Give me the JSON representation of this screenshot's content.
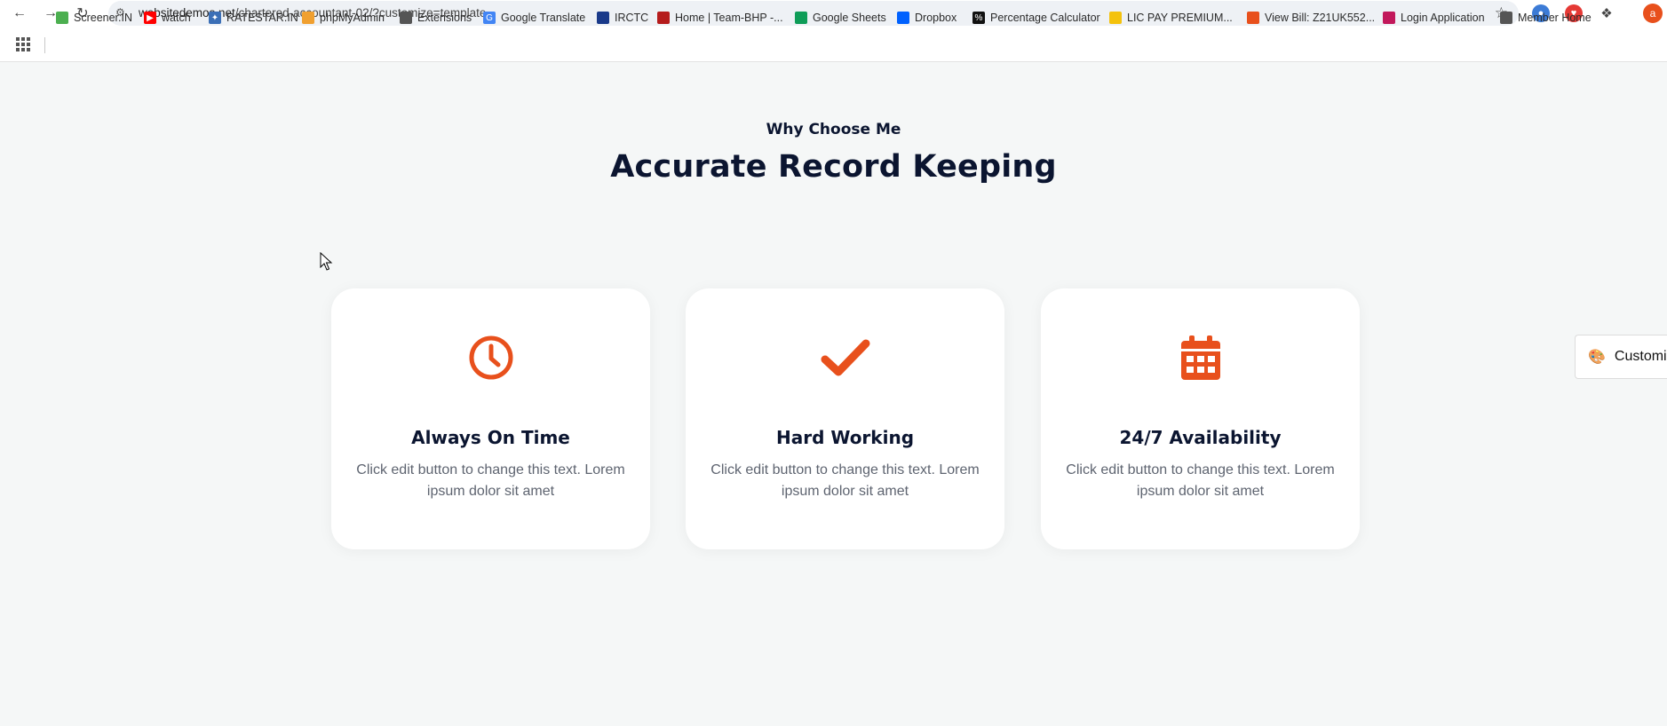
{
  "browser": {
    "url_host": "websitedemos.net",
    "url_path": "/chartered-accountant-02/?customize=template",
    "profile_initial": "a",
    "bookmarks": [
      {
        "label": "Screener.IN",
        "color": "#4caf50"
      },
      {
        "label": "watch",
        "color": "#ff0000"
      },
      {
        "label": "RATESTAR.IN",
        "color": "#3b6fb6"
      },
      {
        "label": "phpMyAdmin",
        "color": "#f0a030"
      },
      {
        "label": "Extensions",
        "color": "#555555"
      },
      {
        "label": "Google Translate",
        "color": "#4285f4"
      },
      {
        "label": "IRCTC",
        "color": "#1a3a8a"
      },
      {
        "label": "Home | Team-BHP -...",
        "color": "#b51c1c"
      },
      {
        "label": "Google Sheets",
        "color": "#0f9d58"
      },
      {
        "label": "Dropbox",
        "color": "#0061fe"
      },
      {
        "label": "Percentage Calculator",
        "color": "#111111"
      },
      {
        "label": "LIC PAY PREMIUM...",
        "color": "#f4c20d"
      },
      {
        "label": "View Bill: Z21UK552...",
        "color": "#e8501c"
      },
      {
        "label": "Login Application",
        "color": "#c2185b"
      },
      {
        "label": "Member Home",
        "color": "#555555"
      }
    ]
  },
  "section": {
    "eyebrow": "Why Choose Me",
    "title": "Accurate Record Keeping"
  },
  "cards": [
    {
      "icon": "clock-icon",
      "title": "Always On Time",
      "text": "Click edit button to change this text. Lorem ipsum dolor sit amet"
    },
    {
      "icon": "checkmark-icon",
      "title": "Hard Working",
      "text": "Click edit button to change this text. Lorem ipsum dolor sit amet"
    },
    {
      "icon": "calendar-icon",
      "title": "24/7 Availability",
      "text": "Click edit button to change this text. Lorem ipsum dolor sit amet"
    }
  ],
  "customize_tab": {
    "label": "Customi"
  },
  "colors": {
    "accent": "#e8501c",
    "heading": "#0b1530",
    "body_text": "#5e6470",
    "page_bg": "#f5f7f7"
  }
}
